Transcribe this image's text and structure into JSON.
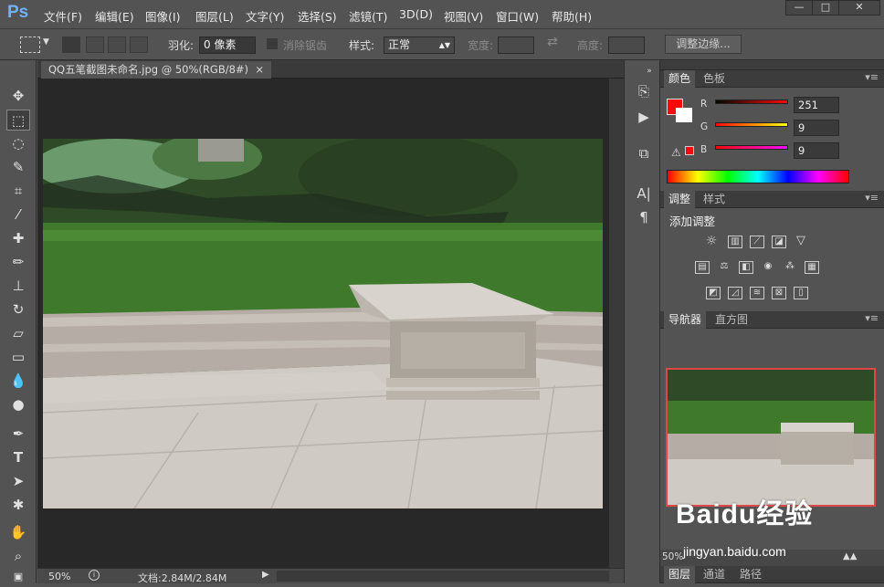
{
  "app": {
    "logo": "Ps"
  },
  "menu": [
    "文件(F)",
    "编辑(E)",
    "图像(I)",
    "图层(L)",
    "文字(Y)",
    "选择(S)",
    "滤镜(T)",
    "3D(D)",
    "视图(V)",
    "窗口(W)",
    "帮助(H)"
  ],
  "window_buttons": {
    "minimize": "—",
    "restore": "□",
    "close": "✕"
  },
  "options": {
    "feather_label": "羽化:",
    "feather_value": "0 像素",
    "antialias_label": "消除锯齿",
    "style_label": "样式:",
    "style_value": "正常",
    "width_label": "宽度:",
    "height_label": "高度:",
    "refine_edge": "调整边缘..."
  },
  "document": {
    "tab_title": "QQ五笔截图未命名.jpg @ 50%(RGB/8#)",
    "tab_close": "×",
    "zoom": "50%",
    "status": "文档:2.84M/2.84M"
  },
  "color_panel": {
    "tabs": [
      "颜色",
      "色板"
    ],
    "r_label": "R",
    "r": "251",
    "g_label": "G",
    "g": "9",
    "b_label": "B",
    "b": "9",
    "foreground": "#fb0909"
  },
  "adjust_panel": {
    "tabs": [
      "调整",
      "样式"
    ],
    "title": "添加调整"
  },
  "navigator_panel": {
    "tabs": [
      "导航器",
      "直方图"
    ],
    "zoom": "50%"
  },
  "layers_panel": {
    "tabs": [
      "图层",
      "通道",
      "路径"
    ]
  },
  "watermark": {
    "brand": "Baidu经验",
    "url": "jingyan.baidu.com"
  }
}
